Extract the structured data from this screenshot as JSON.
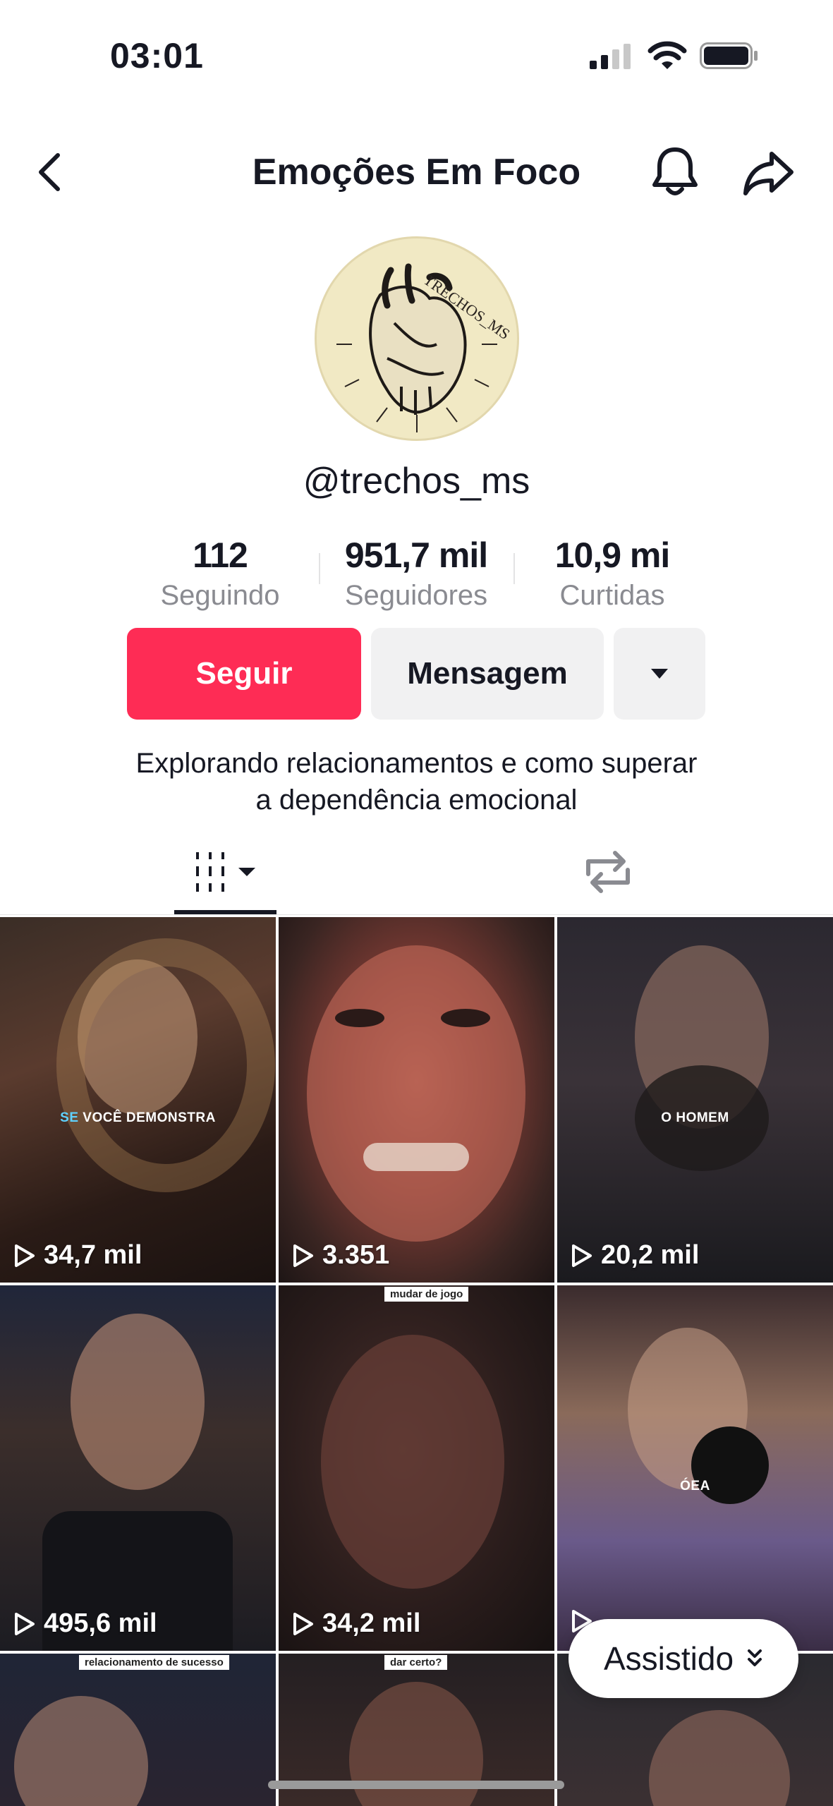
{
  "status_bar": {
    "time": "03:01"
  },
  "header": {
    "title": "Emoções Em Foco"
  },
  "profile": {
    "avatar_text": "TRECHOS_MS",
    "username": "@trechos_ms",
    "stats": [
      {
        "value": "112",
        "label": "Seguindo"
      },
      {
        "value": "951,7 mil",
        "label": "Seguidores"
      },
      {
        "value": "10,9 mi",
        "label": "Curtidas"
      }
    ],
    "buttons": {
      "follow": "Seguir",
      "message": "Mensagem"
    },
    "bio_line1": "Explorando relacionamentos e como superar",
    "bio_line2": "a dependência emocional"
  },
  "grid": {
    "videos": [
      {
        "views": "34,7 mil",
        "caption_highlight": "SE",
        "caption": " VOCÊ DEMONSTRA"
      },
      {
        "views": "3.351"
      },
      {
        "views": "20,2 mil",
        "caption": "O HOMEM"
      },
      {
        "views": "495,6 mil"
      },
      {
        "views": "34,2 mil",
        "top_tag": "mudar de jogo"
      },
      {
        "views": "",
        "caption": "ÓEA"
      },
      {
        "top_tag": "relacionamento de sucesso"
      },
      {
        "top_tag": "dar certo?"
      },
      {}
    ]
  },
  "watched_pill": {
    "label": "Assistido"
  }
}
